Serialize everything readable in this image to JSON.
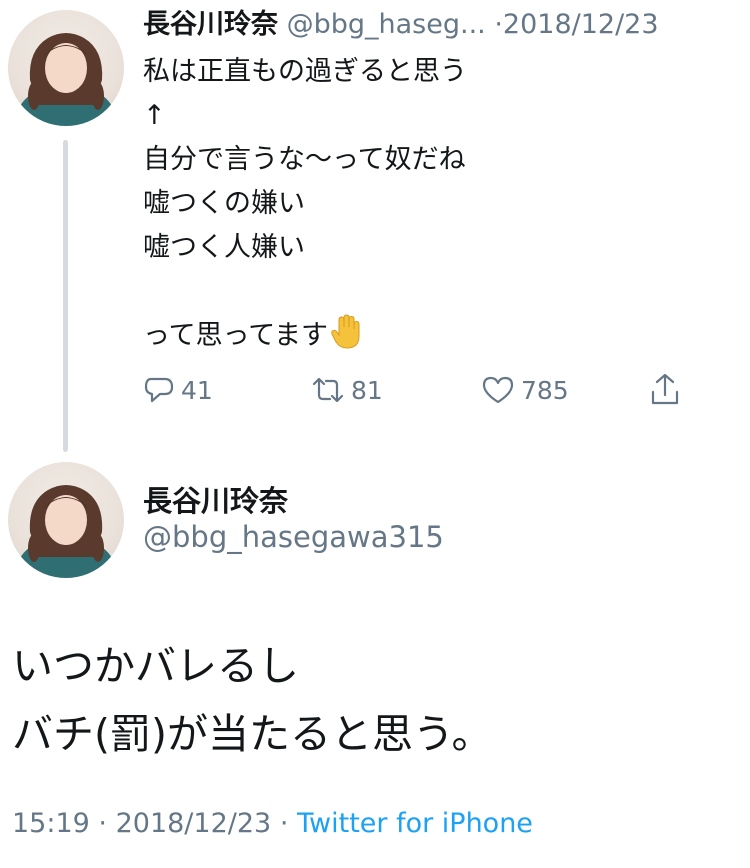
{
  "tweet1": {
    "author_name": "長谷川玲奈",
    "author_handle": "@bbg_haseg...",
    "separator": "·",
    "date": "2018/12/23",
    "lines": [
      "私は正直もの過ぎると思う",
      "↑",
      "自分で言うな〜って奴だね",
      "嘘つくの嫌い",
      "嘘つく人嫌い",
      "",
      "って思ってます"
    ],
    "emoji": "raised-hand-emoji",
    "actions": {
      "replies": "41",
      "retweets": "81",
      "likes": "785"
    }
  },
  "tweet2": {
    "author_name": "長谷川玲奈",
    "author_handle": "@bbg_hasegawa315",
    "lines": [
      "いつかバレるし",
      "バチ(罰)が当たると思う。"
    ],
    "time": "15:19",
    "separator": "·",
    "date": "2018/12/23",
    "client": "Twitter for iPhone"
  },
  "colors": {
    "text": "#14171a",
    "secondary": "#657786",
    "link": "#1da1f2",
    "thread_line": "#d5dade"
  }
}
